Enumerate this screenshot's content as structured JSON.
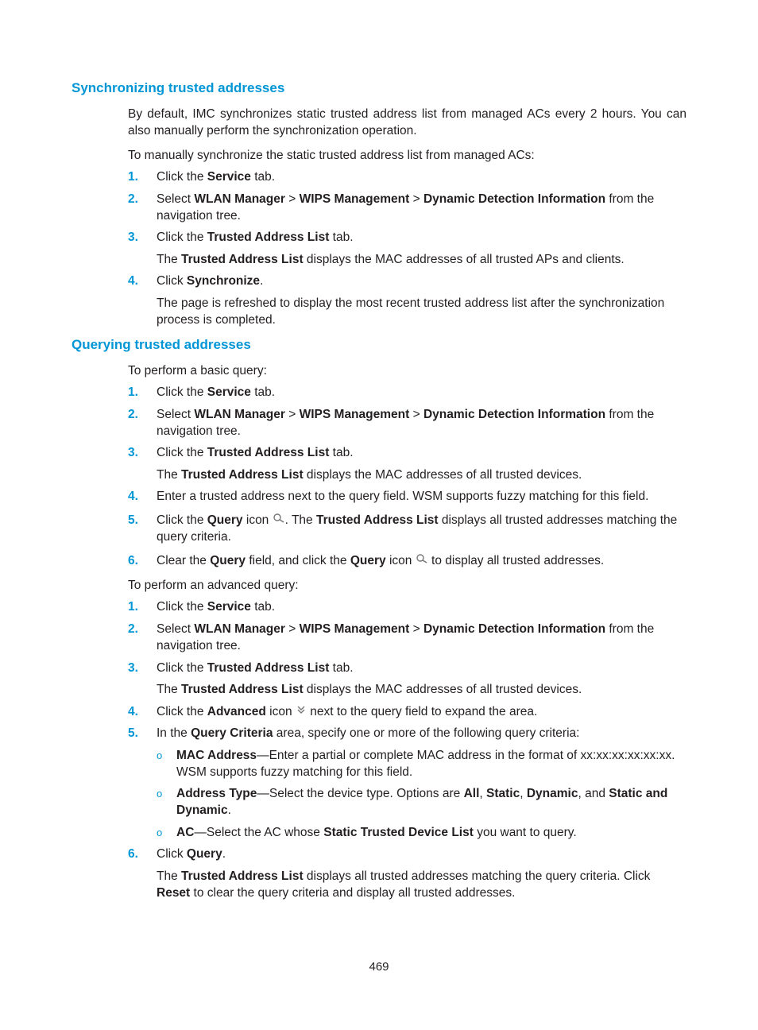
{
  "sections": {
    "sync": {
      "heading": "Synchronizing trusted addresses",
      "intro": "By default, IMC synchronizes static trusted address list from managed ACs every 2 hours. You can also manually perform the synchronization operation.",
      "lead": "To manually synchronize the static trusted address list from managed ACs:",
      "steps": [
        "1.",
        "2.",
        "3.",
        "4."
      ],
      "s1": {
        "a": "Click the ",
        "b": "Service",
        "c": " tab."
      },
      "s2": {
        "a": "Select ",
        "b": "WLAN Manager",
        "c": " > ",
        "d": "WIPS Management",
        "e": " > ",
        "f": "Dynamic Detection Information",
        "g": " from the navigation tree."
      },
      "s3": {
        "a": "Click the ",
        "b": "Trusted Address List",
        "c": " tab."
      },
      "s3note": {
        "a": "The ",
        "b": "Trusted Address List",
        "c": " displays the MAC addresses of all trusted APs and clients."
      },
      "s4": {
        "a": "Click ",
        "b": "Synchronize",
        "c": "."
      },
      "s4note": "The page is refreshed to display the most recent trusted address list after the synchronization process is completed."
    },
    "query": {
      "heading": "Querying trusted addresses",
      "basic_lead": "To perform a basic query:",
      "steps": [
        "1.",
        "2.",
        "3.",
        "4.",
        "5.",
        "6."
      ],
      "b1": {
        "a": "Click the ",
        "b": "Service",
        "c": " tab."
      },
      "b2": {
        "a": "Select ",
        "b": "WLAN Manager",
        "c": " > ",
        "d": "WIPS Management",
        "e": " > ",
        "f": "Dynamic Detection Information",
        "g": " from the navigation tree."
      },
      "b3": {
        "a": "Click the ",
        "b": "Trusted Address List",
        "c": " tab."
      },
      "b3note": {
        "a": "The ",
        "b": "Trusted Address List",
        "c": " displays the MAC addresses of all trusted devices."
      },
      "b4": "Enter a trusted address next to the query field. WSM supports fuzzy matching for this field.",
      "b5": {
        "a": "Click the ",
        "b": "Query",
        "c": " icon ",
        "d": ". The ",
        "e": "Trusted Address List",
        "f": " displays all trusted addresses matching the query criteria."
      },
      "b6": {
        "a": "Clear the ",
        "b": "Query",
        "c": " field, and click the ",
        "d": "Query",
        "e": " icon ",
        "f": " to display all trusted addresses."
      },
      "adv_lead": "To perform an advanced query:",
      "a1": {
        "a": "Click the ",
        "b": "Service",
        "c": " tab."
      },
      "a2": {
        "a": "Select ",
        "b": "WLAN Manager",
        "c": " > ",
        "d": "WIPS Management",
        "e": " > ",
        "f": "Dynamic Detection Information",
        "g": " from the navigation tree."
      },
      "a3": {
        "a": "Click the ",
        "b": "Trusted Address List",
        "c": " tab."
      },
      "a3note": {
        "a": "The ",
        "b": "Trusted Address List",
        "c": " displays the MAC addresses of all trusted devices."
      },
      "a4": {
        "a": "Click the ",
        "b": "Advanced",
        "c": " icon ",
        "d": " next to the query field to expand the area."
      },
      "a5": {
        "a": "In the ",
        "b": "Query Criteria",
        "c": " area, specify one or more of the following query criteria:"
      },
      "bullet_glyph": "o",
      "c1": {
        "b": "MAC Address",
        "a": "—Enter a partial or complete MAC address in the format of xx:xx:xx:xx:xx:xx. WSM supports fuzzy matching for this field."
      },
      "c2": {
        "b": "Address Type",
        "a": "—Select the device type. Options are ",
        "o1": "All",
        "s1": ", ",
        "o2": "Static",
        "s2": ", ",
        "o3": "Dynamic",
        "s3": ", and ",
        "o4": "Static and Dynamic",
        "end": "."
      },
      "c3": {
        "b": "AC",
        "a": "—Select the AC whose ",
        "c": "Static Trusted Device List",
        "d": " you want to query."
      },
      "a6": {
        "a": "Click ",
        "b": "Query",
        "c": "."
      },
      "a6note": {
        "a": "The ",
        "b": "Trusted Address List",
        "c": " displays all trusted addresses matching the query criteria. Click ",
        "d": "Reset",
        "e": " to clear the query criteria and display all trusted addresses."
      }
    }
  },
  "icons": {
    "query": "magnifier-icon",
    "advanced": "double-chevron-down-icon"
  },
  "page_number": "469"
}
